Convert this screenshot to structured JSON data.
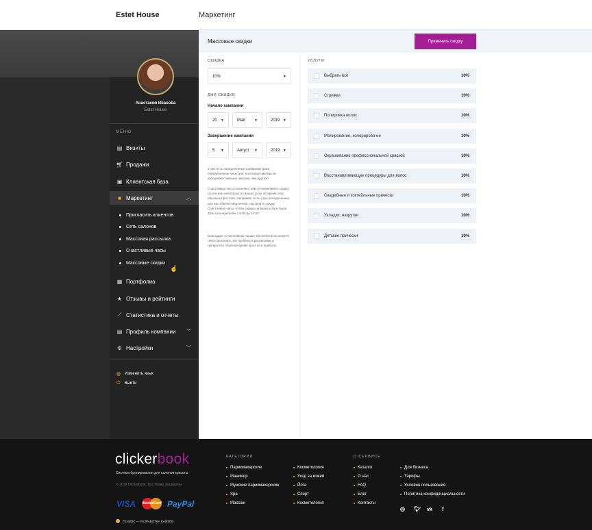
{
  "header": {
    "brand": "Estet House",
    "title": "Маркетинг"
  },
  "user": {
    "name": "Анастасия Иванова",
    "company": "Estet House"
  },
  "sidebar": {
    "menu_caption": "МЕНЮ",
    "items": [
      {
        "label": "Визиты",
        "icon": "clipboard-icon"
      },
      {
        "label": "Продажи",
        "icon": "cart-icon"
      },
      {
        "label": "Клиентская база",
        "icon": "contacts-icon"
      },
      {
        "label": "Маркетинг",
        "icon": "briefcase-icon"
      },
      {
        "label": "Портфолио",
        "icon": "image-icon"
      },
      {
        "label": "Отзывы и рейтинги",
        "icon": "star-icon"
      },
      {
        "label": "Статистика и отчеты",
        "icon": "chart-icon"
      },
      {
        "label": "Профиль компании",
        "icon": "profile-icon"
      },
      {
        "label": "Настройки",
        "icon": "gear-icon"
      }
    ],
    "marketing_sub": [
      "Пригласить клиентов",
      "Сеть салонов",
      "Массовая рассылка",
      "Счастливые часы",
      "Массовые скидки"
    ],
    "util": [
      {
        "label": "Изменить язык",
        "icon": "globe-icon"
      },
      {
        "label": "Выйти",
        "icon": "power-icon"
      }
    ]
  },
  "content": {
    "title": "Массовые скидки",
    "apply_button": "Применить скидку",
    "discount_caption": "СКИДКА",
    "discount_value": "10%",
    "days_caption": "ДНИ СКИДКИ",
    "start_label": "Начало кампании",
    "start": {
      "day": "20",
      "month": "Май",
      "year": "2019"
    },
    "end_label": "Завершение кампании",
    "end": {
      "day": "5",
      "month": "Август",
      "year": "2019"
    },
    "info1": "У вас есть определенные дни/время даже определенные часы дня, в которые никогда не заборняжет меньше заказов, чем других?",
    "info2": "Счастливые часы позволяют вам устанавливать скидку на все или некоторые из ваших услуг во время этих обычных простоев. Например, если утро понедельника для вас обычно медленное, настройте скидку Счастливые часы, чтобы скидка на ваши услуги была 10% в понедельник с 9:00 до 12:00.",
    "info3": "Благодаря «Счастливым часам» Clickerbook вы можете легко заполнить эти пробелы в расписании и превратить обычное время простоя в прибыль.",
    "services_caption": "УСЛУГИ",
    "services": [
      {
        "name": "Выбрать все",
        "pct": "10%"
      },
      {
        "name": "Стрижки",
        "pct": "10%"
      },
      {
        "name": "Полировка волос",
        "pct": "10%"
      },
      {
        "name": "Мелирование, колорирова-ие",
        "pct": "10%"
      },
      {
        "name": "Окрашивание профессиональной краской",
        "pct": "10%"
      },
      {
        "name": "Восстанавливающие процедуры для волос",
        "pct": "10%"
      },
      {
        "name": "Свадебные и коктейльные прически",
        "pct": "10%"
      },
      {
        "name": "Укладки, накрутки",
        "pct": "10%"
      },
      {
        "name": "Детские прически",
        "pct": "10%"
      }
    ]
  },
  "footer": {
    "logo_a": "clicker",
    "logo_b": "book",
    "tagline": "Система бронирования для салонов красоты",
    "copyright": "© 2019 Clickerbook. Все права защищены",
    "payments": {
      "visa": "VISA",
      "mastercard": "MasterCard",
      "paypal": "PayPal"
    },
    "developer": "ГЕНИОС — РАЗРАБОТКА САЙТОВ",
    "categories_caption": "КАТЕГОРИИ",
    "categories_col1": [
      "Парикмахерские",
      "Маникюр",
      "Мужские парикмахерские",
      "Spa",
      "Массаж"
    ],
    "categories_col2": [
      "Косметология",
      "Уход за кожей",
      "Йога",
      "Спорт",
      "Косметология"
    ],
    "about_caption": "О СЕРВИСЕ",
    "about_col1": [
      "Каталог",
      "О нас",
      "FAQ",
      "Блог",
      "Контакты"
    ],
    "about_col2": [
      "Для бизнеса",
      "Тарифы",
      "Условия пользования",
      "Политика конфиденциальности"
    ],
    "social": [
      "instagram-icon",
      "twitter-icon",
      "vk-icon",
      "facebook-icon"
    ]
  },
  "colors": {
    "accent": "#a51f94",
    "sidebar": "#232323",
    "gold": "#e7b23a"
  }
}
